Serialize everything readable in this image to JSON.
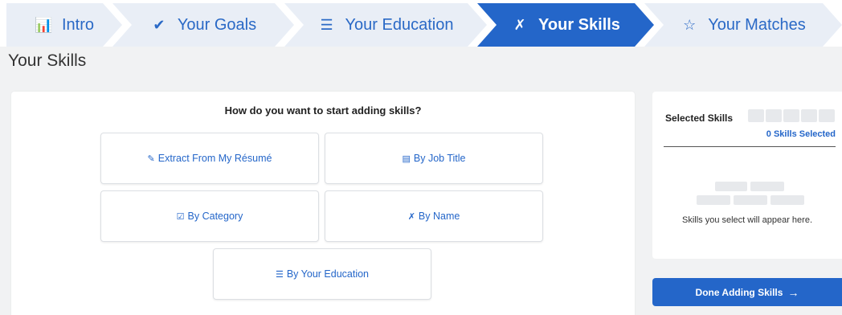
{
  "stepper": {
    "steps": [
      {
        "label": "Intro",
        "icon": "presentation-icon"
      },
      {
        "label": "Your Goals",
        "icon": "rocket-icon"
      },
      {
        "label": "Your Education",
        "icon": "book-icon"
      },
      {
        "label": "Your Skills",
        "icon": "tools-icon",
        "active": true
      },
      {
        "label": "Your Matches",
        "icon": "star-icon"
      }
    ]
  },
  "page": {
    "title": "Your Skills"
  },
  "add_skills": {
    "question": "How do you want to start adding skills?",
    "options": [
      {
        "label": "Extract From My Résumé",
        "icon": "edit-document-icon"
      },
      {
        "label": "By Job Title",
        "icon": "id-card-icon"
      },
      {
        "label": "By Category",
        "icon": "checkbox-icon"
      },
      {
        "label": "By Name",
        "icon": "tools-icon"
      },
      {
        "label": "By Your Education",
        "icon": "book-icon"
      }
    ]
  },
  "selected_panel": {
    "title": "Selected Skills",
    "count_text": "0 Skills Selected",
    "empty_text": "Skills you select will appear here."
  },
  "done_button": {
    "label": "Done Adding Skills"
  },
  "colors": {
    "accent": "#2466c9",
    "step_inactive_bg": "#e9eef6",
    "page_bg": "#f1f2f3"
  }
}
